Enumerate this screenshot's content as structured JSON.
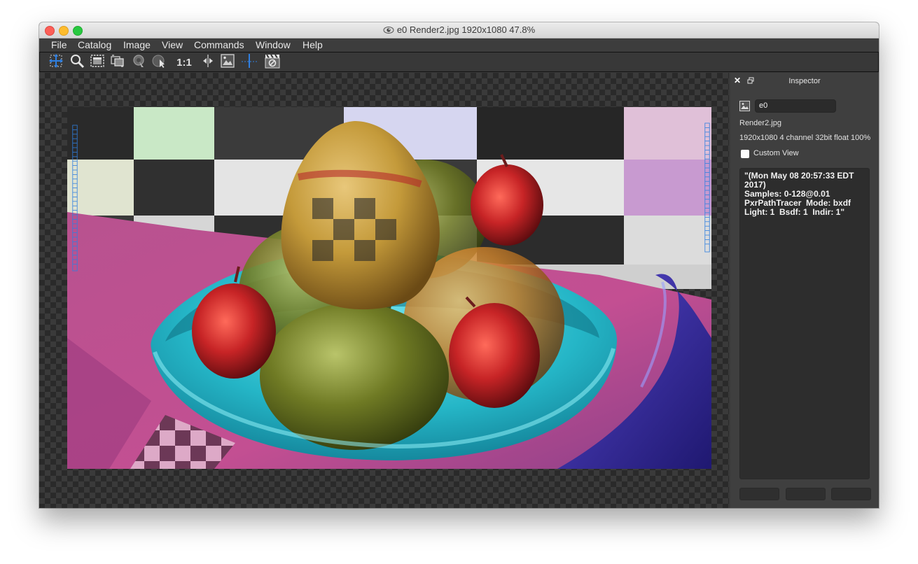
{
  "window": {
    "title": "e0 Render2.jpg 1920x1080 47.8%"
  },
  "menu": [
    "File",
    "Catalog",
    "Image",
    "View",
    "Commands",
    "Window",
    "Help"
  ],
  "toolbar": {
    "tools": [
      "pan-tool-icon",
      "zoom-tool-icon",
      "marquee-select-icon",
      "crop-tool-icon",
      "color-picker-icon",
      "sample-tool-icon",
      "one-to-one-button",
      "compare-split-icon",
      "fit-image-icon",
      "guide-line-icon",
      "clapperboard-icon"
    ],
    "one_to_one_label": "1:1"
  },
  "inspector": {
    "title": "Inspector",
    "name_value": "e0",
    "filename": "Render2.jpg",
    "info": "1920x1080 4 channel 32bit float 100%",
    "custom_view_label": "Custom View",
    "custom_view_checked": false,
    "metadata": "\"(Mon May 08 20:57:33 EDT 2017)\nSamples: 0-128@0.01\nPxrPathTracer  Mode: bxdf\nLight: 1  Bsdf: 1  Indir: 1\""
  },
  "colors": {
    "window_bg": "#3a3a3a",
    "panel_bg": "#3f3f3f",
    "field_bg": "#2d2d2d",
    "accent_blue": "#2f7fe0",
    "bowl_cyan": "#2db7c8"
  }
}
